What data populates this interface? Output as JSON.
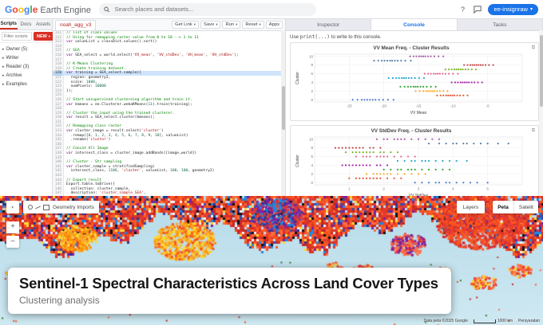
{
  "topbar": {
    "logo_text": "Google",
    "logo_colors": [
      "#4285F4",
      "#EA4335",
      "#FBBC05",
      "#4285F4",
      "#34A853",
      "#EA4335"
    ],
    "product": "Earth Engine",
    "search_placeholder": "Search places and datasets...",
    "profile_label": "ee-insignraw"
  },
  "left_panel": {
    "tabs": [
      {
        "label": "Scripts",
        "active": true
      },
      {
        "label": "Docs",
        "active": false
      },
      {
        "label": "Assets",
        "active": false
      }
    ],
    "filter_placeholder": "Filter scripts",
    "new_button": "NEW",
    "tree": [
      {
        "label": "Owner (5)"
      },
      {
        "label": "Writer"
      },
      {
        "label": "Reader (3)"
      },
      {
        "label": "Archive"
      },
      {
        "label": "Examples"
      }
    ]
  },
  "editor": {
    "file_tab": "noah_agg_v3",
    "buttons": [
      {
        "label": "Get Link",
        "caret": true
      },
      {
        "label": "Save",
        "caret": true
      },
      {
        "label": "Run",
        "caret": true
      },
      {
        "label": "Reset",
        "caret": true
      },
      {
        "label": "Apps",
        "caret": false
      }
    ],
    "start_line": 111,
    "highlight_line": 120,
    "code_lines": [
      "// list of class values",
      "// Using for remapping raster value from 0 to 10 --> 1 to 11",
      "var valueList = classDict.values().sort()",
      "",
      "// SEA",
      "var SEA_select = world.select('VV_mean', 'VV_stdDev', 'VH_mean', 'VH_stdDev');",
      "",
      "// K-Means Clustering",
      "// Create training dataset.",
      "var training = SEA_select.sample({",
      "  region: geometry2,",
      "  scale: 1000,",
      "  numPixels: 10000",
      "});",
      "",
      "// Start unsupervised clustereing algorithm and train it.",
      "var kmeans = ee.Clusterer.wekaKMeans(11).train(training);",
      "",
      "// Cluster the input using the trained clusterer.",
      "var result = SEA_select.cluster(kmeans);",
      "",
      "// Remapping class raster",
      "var cluster_image = result.select('cluster')",
      "  .remap([0, 1, 2, 3, 4, 5, 6, 7, 8, 9, 10], valueList)",
      "  .rename('cluster')",
      "",
      "// Concat All Image",
      "var intersect_class = cluster_image.addBands([image,world])",
      "",
      "// Cluster - Str sampling",
      "var cluster_sample = stratifiedSampling(",
      "  intersect_class, 1106, 'cluster', valueList, 100, 100, geometry2)",
      "",
      "// Export result",
      "Export.table.toDrive({",
      "  collection: cluster_sample,",
      "  description: 'cluster_sample_SEA',"
    ]
  },
  "console_panel": {
    "tabs": [
      "Inspector",
      "Console",
      "Tasks"
    ],
    "active_tab": "Console",
    "hint": "Use print(...) to write to this console."
  },
  "chart_data": [
    {
      "type": "scatter",
      "title": "VV Mean Freq. - Cluster Results",
      "xlabel": "VV Mean",
      "ylabel": "Cluster",
      "xlim": [
        -30,
        0
      ],
      "xticks": [
        -25,
        -20,
        -15,
        -10,
        -5
      ],
      "ylim": [
        -0.5,
        10.5
      ],
      "yticks": [
        0,
        2,
        4,
        6,
        8,
        10
      ],
      "grid": true,
      "legend": false,
      "clusters": [
        {
          "cluster": 0,
          "color": "#3366cc",
          "x": [
            -24.5,
            -23.8,
            -23.2,
            -22.8,
            -22.4,
            -22.0,
            -21.6,
            -21.2,
            -20.7,
            -20.1,
            -19.4,
            -18.6
          ]
        },
        {
          "cluster": 1,
          "color": "#dc3912",
          "x": [
            -12.3,
            -11.8,
            -11.4,
            -11.0,
            -10.7,
            -10.4,
            -10.1,
            -9.8,
            -9.4,
            -9.0,
            -8.5,
            -7.9
          ]
        },
        {
          "cluster": 2,
          "color": "#ff9900",
          "x": [
            -15.4,
            -14.8,
            -14.3,
            -13.9,
            -13.6,
            -13.3,
            -13.0,
            -12.7,
            -12.3,
            -11.9,
            -11.4,
            -10.8
          ]
        },
        {
          "cluster": 3,
          "color": "#109618",
          "x": [
            -17.6,
            -17.0,
            -16.5,
            -16.1,
            -15.7,
            -15.4,
            -15.1,
            -14.7,
            -14.3,
            -13.8,
            -13.2,
            -12.5
          ]
        },
        {
          "cluster": 4,
          "color": "#990099",
          "x": [
            -10.2,
            -9.7,
            -9.3,
            -8.9,
            -8.6,
            -8.3,
            -8.0,
            -7.7,
            -7.3,
            -6.9,
            -6.4,
            -5.8
          ]
        },
        {
          "cluster": 5,
          "color": "#0099c6",
          "x": [
            -19.3,
            -18.7,
            -18.2,
            -17.8,
            -17.4,
            -17.1,
            -16.8,
            -16.4,
            -16.0,
            -15.5,
            -14.9,
            -14.2
          ]
        },
        {
          "cluster": 6,
          "color": "#dd4477",
          "x": [
            -14.1,
            -13.6,
            -13.2,
            -12.8,
            -12.5,
            -12.2,
            -11.9,
            -11.5,
            -11.1,
            -10.6,
            -10.0,
            -9.3
          ]
        },
        {
          "cluster": 7,
          "color": "#66aa00",
          "x": [
            -11.1,
            -10.6,
            -10.2,
            -9.8,
            -9.5,
            -9.2,
            -8.9,
            -8.6,
            -8.2,
            -7.8,
            -7.3,
            -6.7
          ]
        },
        {
          "cluster": 8,
          "color": "#b82e2e",
          "x": [
            -8.4,
            -7.9,
            -7.5,
            -7.2,
            -6.9,
            -6.6,
            -6.3,
            -6.0,
            -5.7,
            -5.3,
            -4.8,
            -4.2
          ]
        },
        {
          "cluster": 9,
          "color": "#316395",
          "x": [
            -21.4,
            -20.8,
            -20.3,
            -19.9,
            -19.5,
            -19.1,
            -18.8,
            -18.4,
            -18.0,
            -17.5,
            -16.9,
            -16.1
          ]
        },
        {
          "cluster": 10,
          "color": "#994499",
          "x": [
            -16.2,
            -15.7,
            -15.3,
            -14.9,
            -14.6,
            -14.3,
            -14.0,
            -13.6,
            -13.2,
            -12.7,
            -12.1,
            -11.4
          ]
        }
      ]
    },
    {
      "type": "scatter",
      "title": "VV StdDev Freq. - Cluster Results",
      "xlabel": "VV StdDev",
      "ylabel": "Cluster",
      "xlim": [
        0,
        6
      ],
      "xticks": [
        1,
        2,
        3,
        4,
        5
      ],
      "ylim": [
        -0.5,
        10.5
      ],
      "yticks": [
        0,
        2,
        4,
        6,
        8,
        10
      ],
      "grid": true,
      "legend": false,
      "clusters": [
        {
          "cluster": 0,
          "color": "#3366cc",
          "x": [
            2.9,
            3.1,
            3.3,
            3.5,
            3.6,
            3.8,
            3.9,
            4.1,
            4.3,
            4.5,
            4.7,
            5.0
          ]
        },
        {
          "cluster": 1,
          "color": "#dc3912",
          "x": [
            1.0,
            1.2,
            1.3,
            1.4,
            1.5,
            1.6,
            1.7,
            1.8,
            1.9,
            2.1,
            2.3,
            2.5
          ]
        },
        {
          "cluster": 2,
          "color": "#ff9900",
          "x": [
            1.5,
            1.7,
            1.8,
            1.9,
            2.0,
            2.1,
            2.2,
            2.4,
            2.6,
            2.8,
            3.0,
            3.2
          ]
        },
        {
          "cluster": 3,
          "color": "#109618",
          "x": [
            2.0,
            2.2,
            2.4,
            2.5,
            2.7,
            2.8,
            2.9,
            3.1,
            3.3,
            3.5,
            3.7,
            3.9
          ]
        },
        {
          "cluster": 4,
          "color": "#990099",
          "x": [
            0.8,
            0.9,
            1.0,
            1.1,
            1.2,
            1.3,
            1.4,
            1.5,
            1.6,
            1.8,
            1.9,
            2.1
          ]
        },
        {
          "cluster": 5,
          "color": "#0099c6",
          "x": [
            2.4,
            2.6,
            2.8,
            2.9,
            3.1,
            3.2,
            3.3,
            3.5,
            3.7,
            3.9,
            4.1,
            4.4
          ]
        },
        {
          "cluster": 6,
          "color": "#dd4477",
          "x": [
            1.2,
            1.4,
            1.5,
            1.6,
            1.8,
            1.9,
            2.0,
            2.1,
            2.3,
            2.5,
            2.7,
            2.9
          ]
        },
        {
          "cluster": 7,
          "color": "#66aa00",
          "x": [
            0.9,
            1.1,
            1.2,
            1.3,
            1.4,
            1.5,
            1.6,
            1.7,
            1.9,
            2.0,
            2.2,
            2.4
          ]
        },
        {
          "cluster": 8,
          "color": "#b82e2e",
          "x": [
            0.6,
            0.7,
            0.8,
            0.9,
            1.0,
            1.1,
            1.2,
            1.3,
            1.4,
            1.6,
            1.7,
            1.9
          ]
        },
        {
          "cluster": 9,
          "color": "#316395",
          "x": [
            3.3,
            3.6,
            3.8,
            4.0,
            4.1,
            4.3,
            4.4,
            4.6,
            4.8,
            5.0,
            5.3,
            5.6
          ]
        },
        {
          "cluster": 10,
          "color": "#994499",
          "x": [
            1.8,
            2.0,
            2.1,
            2.3,
            2.4,
            2.5,
            2.6,
            2.8,
            3.0,
            3.2,
            3.4,
            3.6
          ]
        }
      ]
    }
  ],
  "map": {
    "geometry_imports_label": "Geometry Imports",
    "layers_button": "Layers",
    "map_type_map": "Peta",
    "map_type_satellite": "Satelit",
    "zoom_in": "+",
    "zoom_out": "−",
    "scale_text": "1000 km",
    "attribution": "Data peta ©2025 Google",
    "terms": "Persyaratan",
    "ocean_color": "#bfe0ec",
    "cluster_colors": [
      "#e03a2f",
      "#f4511e",
      "#ff5722",
      "#d93025",
      "#ff6d3d",
      "#c62828",
      "#1e88e5",
      "#283593",
      "#7b1fa2",
      "#fdd835",
      "#43a047",
      "#00897b",
      "#111111",
      "#f6f6f6"
    ]
  },
  "caption": {
    "title": "Sentinel-1 Spectral Characteristics Across Land Cover Types",
    "subtitle": "Clustering analysis"
  }
}
